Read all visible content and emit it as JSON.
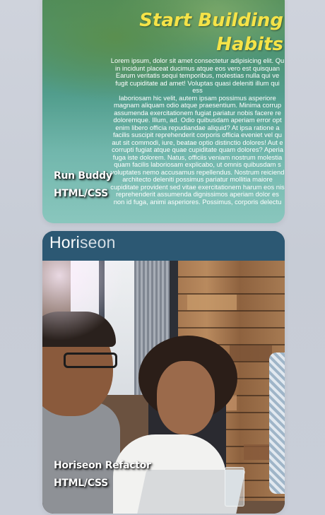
{
  "projects": [
    {
      "title": "Run Buddy",
      "tech": "HTML/CSS",
      "image": {
        "headline_line1": "Start Building",
        "headline_line2": "Habits",
        "body_text": "Lorem ipsum, dolor sit amet consectetur adipisicing elit. Qu\nin incidunt placeat ducimus atque eos vero est quisquan\nEarum veritatis sequi temporibus, molestias nulla qui ve\nfugit cupiditate ad amet! Voluptas quasi deleniti illum qui ess\nlaboriosam hic velit, autem ipsam possimus asperiore\nmagnam aliquam odio atque praesentium. Minima corrup\nassumenda exercitationem fugiat pariatur nobis facere re\ndoloremque. Illum, ad. Odio quibusdam aperiam error opt\nenim libero officia repudiandae aliquid? At ipsa ratione a\nfacilis suscipit reprehenderit corporis officia eveniet vel qu\naut sit commodi, iure, beatae optio distinctio dolores! Aut e\ncorrupti fugiat atque quae cupiditate quam dolores? Aperia\nfuga iste dolorem. Natus, officiis veniam nostrum molestia\nquam facilis laboriosam explicabo, ut omnis quibusdam s\nvoluptates nemo accusamus repellendus. Nostrum reiciend\narchitecto deleniti possimus pariatur mollitia maiore\ncupiditate provident sed vitae exercitationem harum eos nis\nreprehenderit assumenda dignissimos aperiam dolor es\nnon id fuga, animi asperiores. Possimus, corporis delectu"
      }
    },
    {
      "title": "Horiseon Refactor",
      "tech": "HTML/CSS",
      "image": {
        "brand_part1": "Hori",
        "brand_part2": "seon"
      }
    }
  ],
  "colors": {
    "page_background": "#c9ced8",
    "headline_yellow": "#f5e348",
    "horiseon_bar": "#2c5873"
  }
}
